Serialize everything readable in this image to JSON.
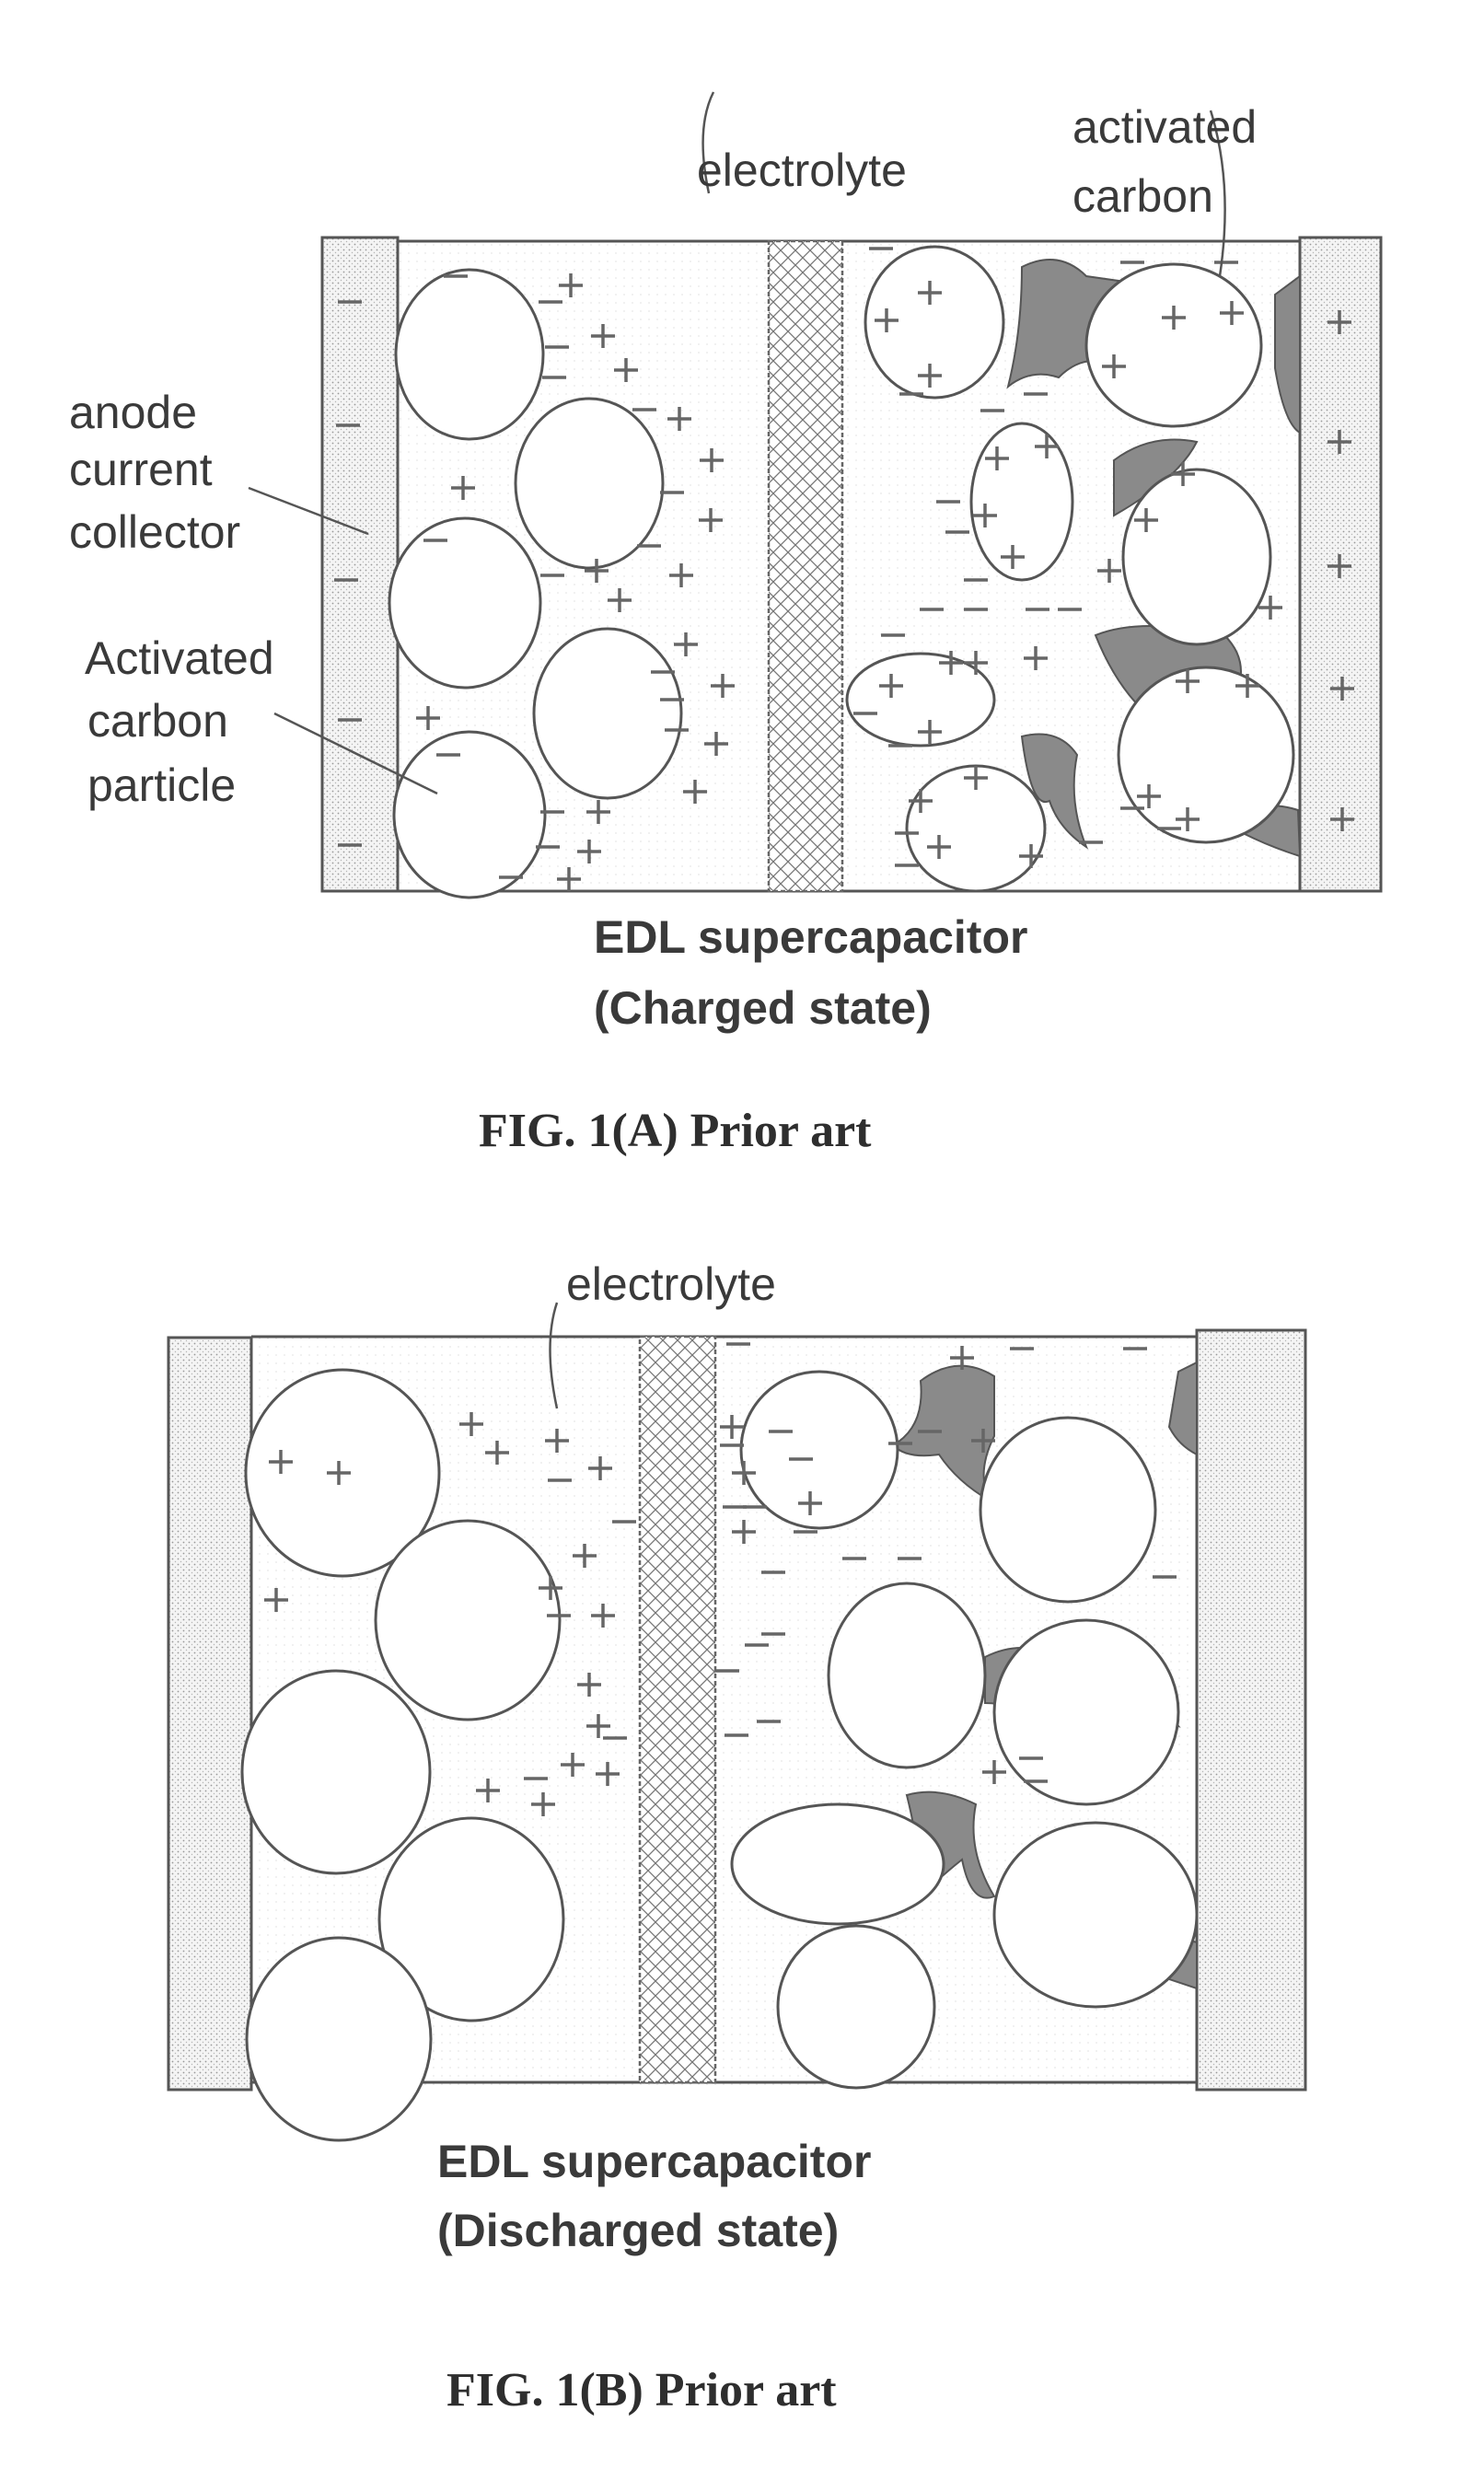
{
  "figure_a": {
    "labels": {
      "electrolyte": "electrolyte",
      "activated_carbon_line1": "activated",
      "activated_carbon_line2": "carbon",
      "anode_line1": "anode",
      "anode_line2": "current",
      "anode_line3": "collector",
      "particle_line1": "Activated",
      "particle_line2": "carbon",
      "particle_line3": "particle"
    },
    "caption_line1": "EDL supercapacitor",
    "caption_line2": "(Charged state)",
    "figure_label": "FIG. 1(A) Prior art",
    "state": "charged"
  },
  "figure_b": {
    "labels": {
      "electrolyte": "electrolyte"
    },
    "caption_line1": "EDL supercapacitor",
    "caption_line2": "(Discharged state)",
    "figure_label": "FIG. 1(B) Prior art",
    "state": "discharged"
  },
  "colors": {
    "line": "#555555",
    "binder": "#8a8a8a",
    "text": "#3a3a3a"
  }
}
